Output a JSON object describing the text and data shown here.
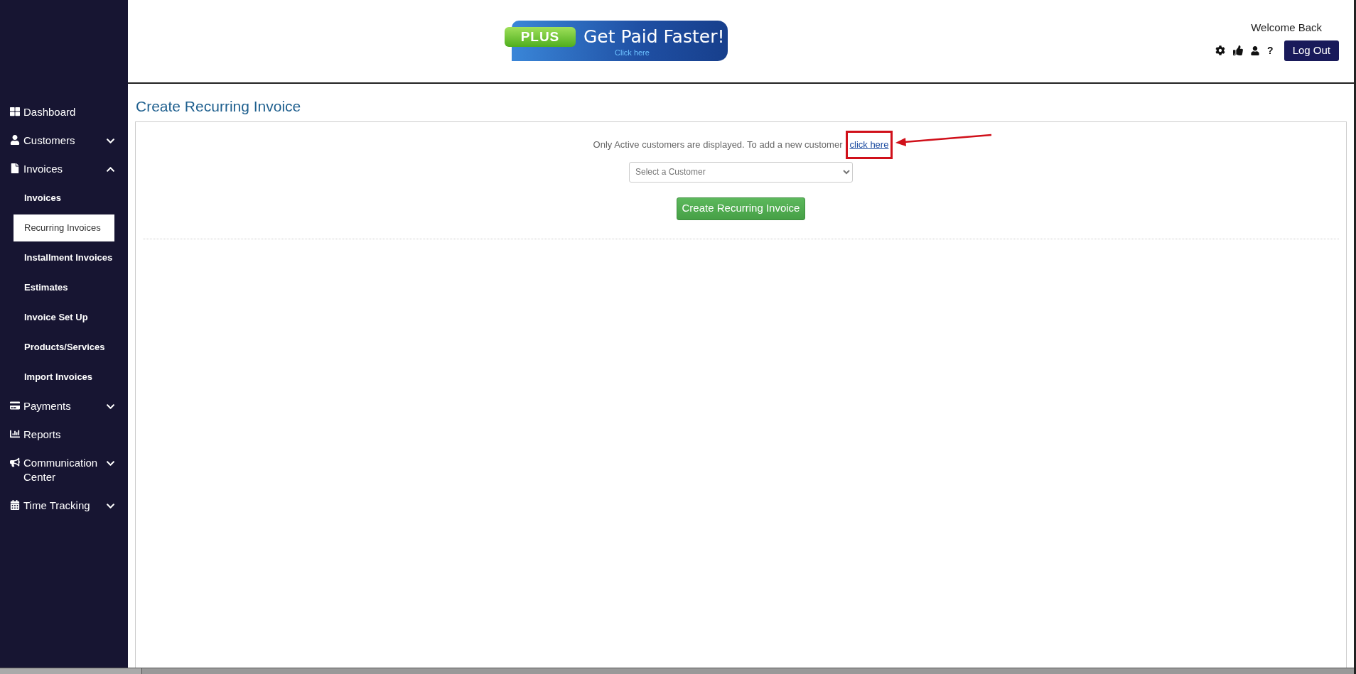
{
  "banner": {
    "badge": "PLUS",
    "headline": "Get Paid Faster!",
    "link": "Click here"
  },
  "header": {
    "greeting": "Welcome Back",
    "help": "?",
    "logout": "Log Out"
  },
  "sidebar": {
    "items": [
      {
        "kind": "dashboard",
        "label": "Dashboard"
      },
      {
        "kind": "customers",
        "label": "Customers",
        "expanded": false
      },
      {
        "kind": "invoices",
        "label": "Invoices",
        "expanded": true,
        "children": [
          {
            "label": "Invoices",
            "selected": false
          },
          {
            "label": "Recurring Invoices",
            "selected": true
          },
          {
            "label": "Installment Invoices",
            "selected": false
          },
          {
            "label": "Estimates",
            "selected": false
          },
          {
            "label": "Invoice Set Up",
            "selected": false
          },
          {
            "label": "Products/Services",
            "selected": false
          },
          {
            "label": "Import Invoices",
            "selected": false
          }
        ]
      },
      {
        "kind": "payments",
        "label": "Payments",
        "expanded": false
      },
      {
        "kind": "reports",
        "label": "Reports"
      },
      {
        "kind": "communication",
        "label": "Communication Center",
        "expanded": false
      },
      {
        "kind": "time",
        "label": "Time Tracking",
        "expanded": false
      }
    ]
  },
  "page": {
    "title": "Create Recurring Invoice",
    "notice": "Only Active customers are displayed. To add a new customer",
    "notice_link": "click here",
    "customer_select": {
      "placeholder": "Select a Customer"
    },
    "submit": "Create Recurring Invoice"
  }
}
